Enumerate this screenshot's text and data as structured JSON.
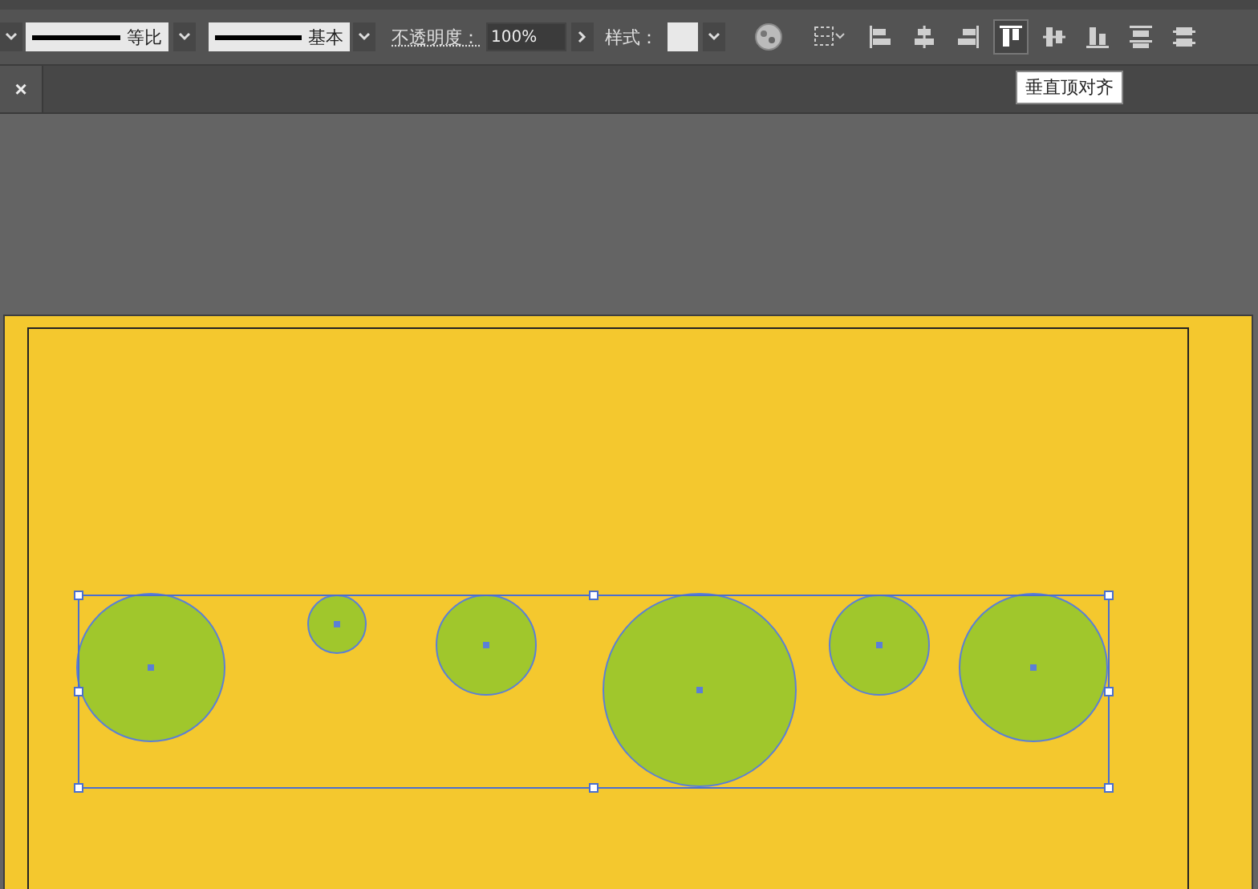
{
  "toolbar": {
    "stroke_profile": {
      "label": "等比"
    },
    "brush": {
      "label": "基本"
    },
    "opacity": {
      "label": "不透明度：",
      "value": "100%"
    },
    "style": {
      "label": "样式："
    },
    "align_buttons": [
      {
        "kind": "left",
        "selected": false
      },
      {
        "kind": "hcenter",
        "selected": false
      },
      {
        "kind": "right",
        "selected": false
      },
      {
        "kind": "top",
        "selected": true
      },
      {
        "kind": "vcenter",
        "selected": false
      },
      {
        "kind": "bottom",
        "selected": false
      },
      {
        "kind": "dtop",
        "selected": false
      },
      {
        "kind": "dcenter",
        "selected": false
      }
    ],
    "tooltip": "垂直顶对齐"
  },
  "document_tab": {
    "close": "×"
  }
}
